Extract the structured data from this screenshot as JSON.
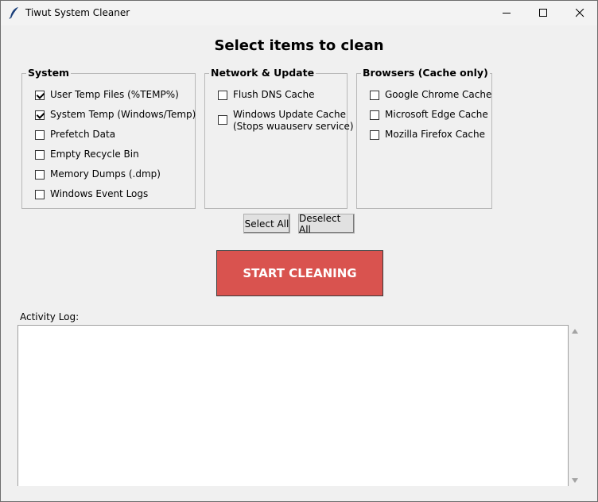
{
  "window": {
    "title": "Tiwut System Cleaner",
    "icon": "feather-icon"
  },
  "heading": "Select items to clean",
  "groups": {
    "system": {
      "title": "System",
      "items": [
        {
          "label": "User Temp Files (%TEMP%)",
          "checked": true
        },
        {
          "label": "System Temp (Windows/Temp)",
          "checked": true
        },
        {
          "label": "Prefetch Data",
          "checked": false
        },
        {
          "label": "Empty Recycle Bin",
          "checked": false
        },
        {
          "label": "Memory Dumps (.dmp)",
          "checked": false
        },
        {
          "label": "Windows Event Logs",
          "checked": false
        }
      ]
    },
    "network": {
      "title": "Network & Update",
      "items": [
        {
          "label": "Flush DNS Cache",
          "checked": false
        },
        {
          "label": "Windows Update Cache",
          "sublabel": "(Stops wuauserv service)",
          "checked": false
        }
      ]
    },
    "browsers": {
      "title": "Browsers (Cache only)",
      "items": [
        {
          "label": "Google Chrome Cache",
          "checked": false
        },
        {
          "label": "Microsoft Edge Cache",
          "checked": false
        },
        {
          "label": "Mozilla Firefox Cache",
          "checked": false
        }
      ]
    }
  },
  "buttons": {
    "select_all": "Select All",
    "deselect_all": "Deselect All",
    "start": "START CLEANING"
  },
  "log": {
    "label": "Activity Log:",
    "content": ""
  },
  "colors": {
    "start_button": "#d9534f",
    "background": "#f0f0f0"
  }
}
